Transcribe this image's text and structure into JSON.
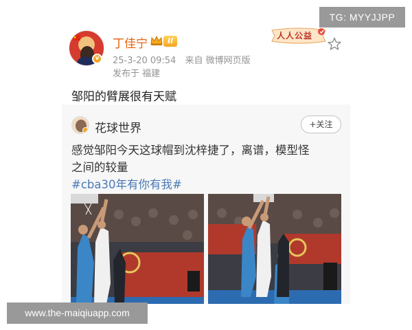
{
  "post": {
    "username": "丁佳宁",
    "level_badge": "II",
    "time": "25-3-20 09:54",
    "source": "来自 微博网页版",
    "location": "发布于 福建",
    "text": "邹阳的臂展很有天赋",
    "public_badge": "人人公益",
    "icons": {
      "avatar": "user-avatar",
      "crown": "crown-icon",
      "star": "star-icon",
      "verified": "verified-badge-icon"
    }
  },
  "repost": {
    "author": "花球世界",
    "follow_label": "+关注",
    "text_line1": "感觉邹阳今天这球帽到沈梓捷了，离谱，模型怪",
    "text_line2": "之间的较量",
    "hashtag": "#cba30年有你有我#",
    "images": [
      "basketball-photo-1",
      "basketball-photo-2"
    ]
  },
  "overlays": {
    "tg": "TG: MYYJJPP",
    "watermark": "www.the-maiqiuapp.com"
  },
  "colors": {
    "username": "#e8620f",
    "hashtag": "#4a78b5",
    "badge_gold": "#f5a623"
  }
}
